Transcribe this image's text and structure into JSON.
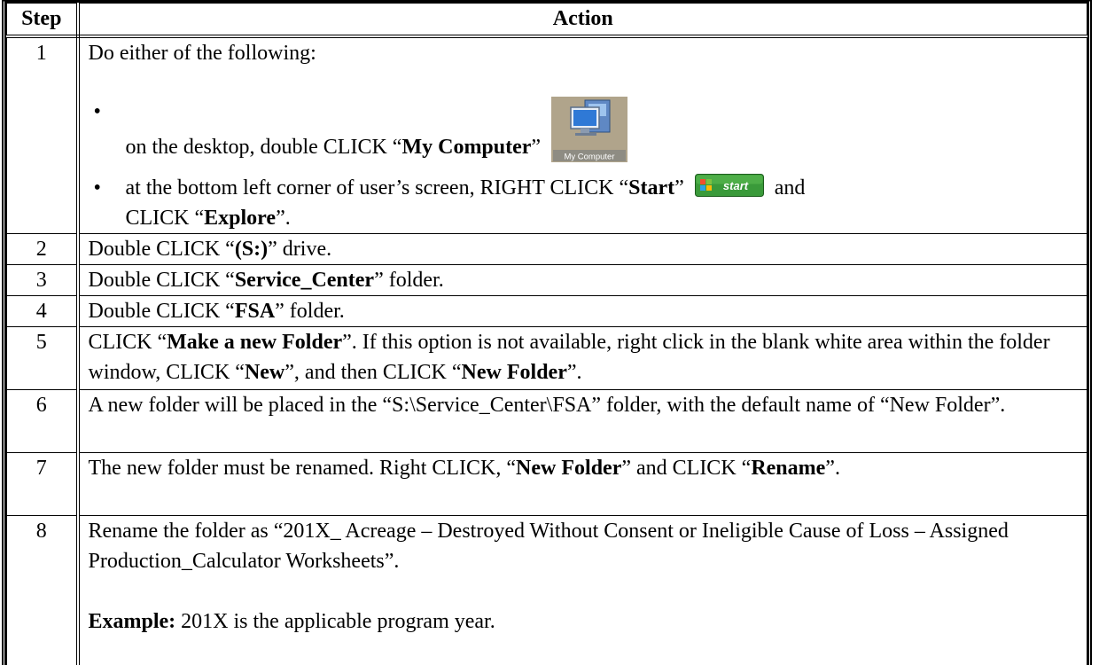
{
  "table": {
    "header": {
      "step": "Step",
      "action": "Action"
    },
    "rows": {
      "r1": {
        "step": "1",
        "intro": "Do either of the following:",
        "b1_pre": "on the desktop, double CLICK “",
        "b1_bold": "My Computer",
        "b1_post": "”",
        "b2_pre": "at the bottom left corner of user’s screen, RIGHT CLICK “",
        "b2_bold": "Start",
        "b2_mid": "”",
        "b2_and": "and",
        "b2_line2_pre": "CLICK “",
        "b2_line2_bold": "Explore",
        "b2_line2_post": "”."
      },
      "r2": {
        "step": "2",
        "pre": "Double CLICK “",
        "bold": "(S:)",
        "post": "” drive."
      },
      "r3": {
        "step": "3",
        "pre": "Double CLICK “",
        "bold": "Service_Center",
        "post": "” folder."
      },
      "r4": {
        "step": "4",
        "pre": "Double CLICK “",
        "bold": "FSA",
        "post": "” folder."
      },
      "r5": {
        "step": "5",
        "t1": "CLICK “",
        "b1": "Make a new Folder",
        "t2": "”. If this option is not available, right click in the blank white area within the folder window, CLICK “",
        "b2": "New",
        "t3": "”, and then CLICK “",
        "b3": "New Folder",
        "t4": "”."
      },
      "r6": {
        "step": "6",
        "text": "A new folder will be placed in the “S:\\Service_Center\\FSA” folder, with the default name of “New Folder”."
      },
      "r7": {
        "step": "7",
        "t1": "The new folder must be renamed.  Right CLICK, “",
        "b1": "New Folder",
        "t2": "” and CLICK “",
        "b2": "Rename",
        "t3": "”."
      },
      "r8": {
        "step": "8",
        "text": "Rename the folder as “201X_ Acreage – Destroyed Without Consent or Ineligible Cause of Loss – Assigned Production_Calculator Worksheets”.",
        "example_label": "Example:",
        "example_text": " 201X is the applicable program year."
      }
    }
  },
  "icons": {
    "my_computer": {
      "name": "my-computer-icon",
      "caption": "My Computer"
    },
    "start_button": {
      "name": "start-button-icon",
      "label": "start"
    }
  },
  "bullet_glyph": "•"
}
